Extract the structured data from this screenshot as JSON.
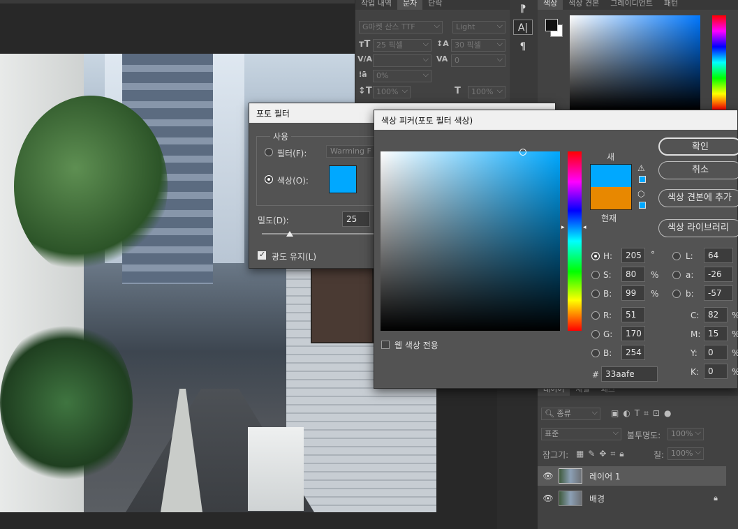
{
  "char_panel": {
    "tabs": [
      "작업 내역",
      "문자",
      "단락"
    ],
    "font_family": "G마켓 산스 TTF",
    "font_style": "Light",
    "font_size": "25 픽셀",
    "leading": "30 픽셀",
    "kerning": "",
    "tracking": "0",
    "tsume": "0%",
    "vscale": "100%",
    "hscale": "100%"
  },
  "color_panel": {
    "tabs": [
      "색상",
      "색상 견본",
      "그레이디언트",
      "패턴"
    ]
  },
  "photo_filter": {
    "title": "포토 필터",
    "group_label": "사용",
    "filter_label": "필터(F):",
    "filter_value": "Warming F",
    "color_label": "색상(O):",
    "swatch_color": "#00a8ff",
    "density_label": "밀도(D):",
    "density_value": "25",
    "density_percent": 25,
    "preserve_label": "광도 유지(L)",
    "preserve_checked": true
  },
  "color_picker": {
    "title": "색상 피커(포토 필터 색상)",
    "new_label": "새",
    "current_label": "현재",
    "new_color": "#00a8ff",
    "current_color": "#e88800",
    "ok_button": "확인",
    "cancel_button": "취소",
    "add_swatch_button": "색상 견본에 추가",
    "library_button": "색상 라이브러리",
    "web_colors_label": "웹 색상 전용",
    "h": {
      "label": "H:",
      "value": "205",
      "unit": "°"
    },
    "s": {
      "label": "S:",
      "value": "80",
      "unit": "%"
    },
    "b": {
      "label": "B:",
      "value": "99",
      "unit": "%"
    },
    "r": {
      "label": "R:",
      "value": "51"
    },
    "g": {
      "label": "G:",
      "value": "170"
    },
    "bb": {
      "label": "B:",
      "value": "254"
    },
    "lab_l": {
      "label": "L:",
      "value": "64"
    },
    "lab_a": {
      "label": "a:",
      "value": "-26"
    },
    "lab_b": {
      "label": "b:",
      "value": "-57"
    },
    "c": {
      "label": "C:",
      "value": "82",
      "unit": "%"
    },
    "m": {
      "label": "M:",
      "value": "15",
      "unit": "%"
    },
    "y": {
      "label": "Y:",
      "value": "0",
      "unit": "%"
    },
    "k": {
      "label": "K:",
      "value": "0",
      "unit": "%"
    },
    "hex_label": "#",
    "hex": "33aafe"
  },
  "layers_panel": {
    "tabs": [
      "레이어",
      "채널",
      "패스"
    ],
    "filter_kind": "종류",
    "blend_mode": "표준",
    "opacity_label": "불투명도:",
    "opacity": "100%",
    "lock_label": "잠그기:",
    "fill_label": "칠:",
    "fill": "100%",
    "layers": [
      {
        "name": "레이어 1"
      },
      {
        "name": "배경"
      }
    ]
  }
}
